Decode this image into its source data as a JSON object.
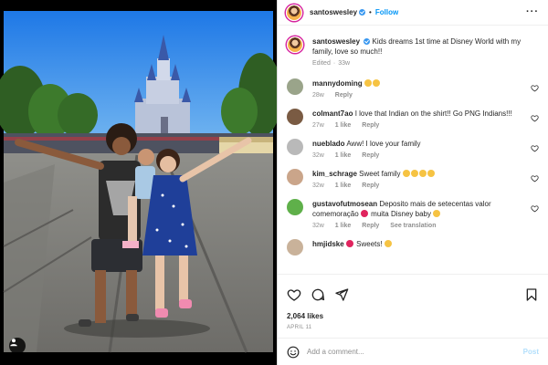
{
  "header": {
    "username": "santoswesley",
    "follow_label": "Follow",
    "more_label": "···"
  },
  "caption": {
    "username": "santoswesley",
    "text": "Kids dreams 1st time at Disney World with my family, love so much!!",
    "edited": "Edited",
    "age": "33w"
  },
  "comments": [
    {
      "username": "mannydoming",
      "text": "",
      "emoji_count": 2,
      "age": "28w",
      "likes": "",
      "reply": "Reply",
      "avatar_color": "#9aa48a"
    },
    {
      "username": "colmant7ao",
      "text": "I love that Indian on the shirt!! Go PNG Indians!!!",
      "emoji_count": 0,
      "age": "27w",
      "likes": "1 like",
      "reply": "Reply",
      "avatar_color": "#7a5b43"
    },
    {
      "username": "nueblado",
      "text": "Aww! I love your family",
      "emoji_count": 0,
      "age": "32w",
      "likes": "1 like",
      "reply": "Reply",
      "avatar_color": "#b9b9b9"
    },
    {
      "username": "kim_schrage",
      "text": "Sweet family",
      "emoji_count": 4,
      "age": "32w",
      "likes": "1 like",
      "reply": "Reply",
      "avatar_color": "#caa58a"
    },
    {
      "username": "gustavofutmosean",
      "text": "Deposito mais de setecentas valor comemoração",
      "text2": "muita Disney baby",
      "emoji_count": 0,
      "age": "32w",
      "likes": "1 like",
      "reply": "Reply",
      "see_translation": "See translation",
      "avatar_color": "#5fb04a"
    },
    {
      "username": "hmjidske",
      "text": "Sweets!",
      "emoji_count": 1,
      "age": "",
      "likes": "",
      "reply": "",
      "avatar_color": "#c9b29a"
    }
  ],
  "actions": {
    "likes": "2,064 likes",
    "date": "APRIL 11"
  },
  "add_comment": {
    "placeholder": "Add a comment...",
    "post_label": "Post"
  },
  "colors": {
    "link_blue": "#0095f6",
    "post_disabled": "#b2dffc",
    "muted_text": "#8e8e8e",
    "border": "#dbdbdb"
  },
  "icons": [
    "heart-icon",
    "comment-icon",
    "share-icon",
    "bookmark-icon",
    "emoji-icon",
    "user-tag-icon",
    "verified-badge-icon",
    "more-options-icon"
  ]
}
